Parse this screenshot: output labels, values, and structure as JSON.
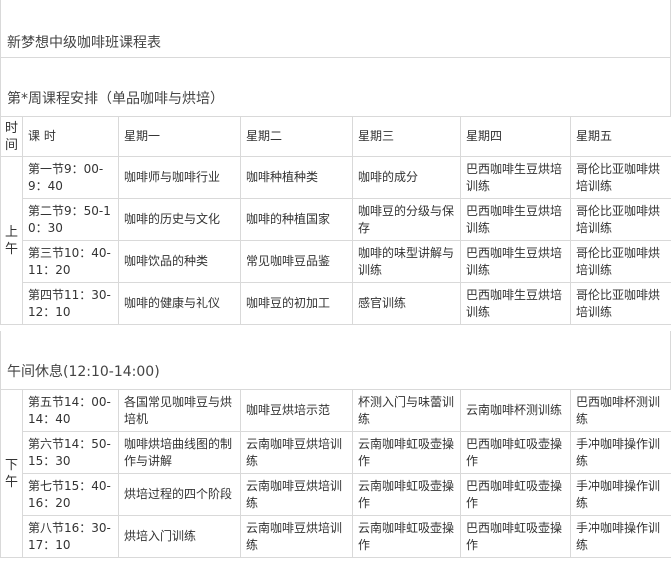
{
  "title": "新梦想中级咖啡班课程表",
  "week_heading": "第*周课程安排（单品咖啡与烘培）",
  "header": {
    "time": "时间",
    "slot": "课 时",
    "days": [
      "星期一",
      "星期二",
      "星期三",
      "星期四",
      "星期五"
    ]
  },
  "morning": {
    "label": "上午",
    "rows": [
      {
        "slot": "第一节9：00-9：40",
        "cells": [
          "咖啡师与咖啡行业",
          "咖啡种植种类",
          "咖啡的成分",
          "巴西咖啡生豆烘培训练",
          "哥伦比亚咖啡烘培训练"
        ]
      },
      {
        "slot": "第二节9：50-10：30",
        "cells": [
          "咖啡的历史与文化",
          "咖啡的种植国家",
          "咖啡豆的分级与保存",
          "巴西咖啡生豆烘培训练",
          "哥伦比亚咖啡烘培训练"
        ]
      },
      {
        "slot": "第三节10：40-11：20",
        "cells": [
          "咖啡饮品的种类",
          "常见咖啡豆品鉴",
          "咖啡的味型讲解与训练",
          "巴西咖啡生豆烘培训练",
          "哥伦比亚咖啡烘培训练"
        ]
      },
      {
        "slot": "第四节11：30-12：10",
        "cells": [
          "咖啡的健康与礼仪",
          "咖啡豆的初加工",
          "感官训练",
          "巴西咖啡生豆烘培训练",
          "哥伦比亚咖啡烘培训练"
        ]
      }
    ]
  },
  "lunch_break": "午间休息(12:10-14:00)",
  "afternoon": {
    "label": "下午",
    "rows": [
      {
        "slot": "第五节14：00-14：40",
        "cells": [
          "各国常见咖啡豆与烘培机",
          "咖啡豆烘培示范",
          "杯测入门与味蕾训练",
          "云南咖啡杯测训练",
          "巴西咖啡杯测训练"
        ]
      },
      {
        "slot": "第六节14：50-15：30",
        "cells": [
          "咖啡烘培曲线图的制作与讲解",
          "云南咖啡豆烘培训练",
          "云南咖啡虹吸壶操作",
          "巴西咖啡虹吸壶操作",
          "手冲咖啡操作训练"
        ]
      },
      {
        "slot": "第七节15：40-16：20",
        "cells": [
          "烘培过程的四个阶段",
          "云南咖啡豆烘培训练",
          "云南咖啡虹吸壶操作",
          "巴西咖啡虹吸壶操作",
          "手冲咖啡操作训练"
        ]
      },
      {
        "slot": "第八节16：30-17：10",
        "cells": [
          "烘培入门训练",
          "云南咖啡豆烘培训练",
          "云南咖啡虹吸壶操作",
          "巴西咖啡虹吸壶操作",
          "手冲咖啡操作训练"
        ]
      }
    ]
  }
}
